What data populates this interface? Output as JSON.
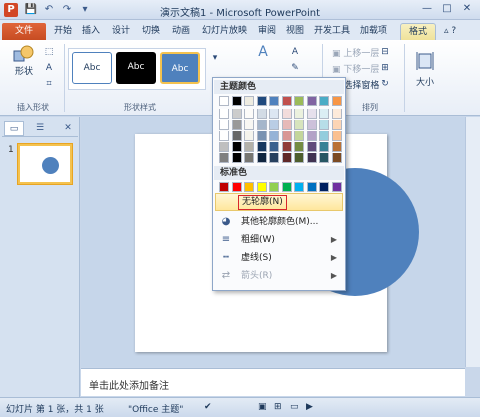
{
  "title_bar": {
    "app_icon": "P",
    "title": "演示文稿1 - Microsoft PowerPoint",
    "qat_icons": [
      "save-icon",
      "undo-icon",
      "redo-icon",
      "customize-icon"
    ],
    "window_buttons": [
      "—",
      "□",
      "✕"
    ]
  },
  "tabs": {
    "file": "文件",
    "items": [
      "开始",
      "插入",
      "设计",
      "切换",
      "动画",
      "幻灯片放映",
      "审阅",
      "视图",
      "开发工具",
      "加载项"
    ],
    "active": "格式"
  },
  "ribbon": {
    "insert_shapes": {
      "button": "形状",
      "label": "插入形状"
    },
    "shape_styles": {
      "tiles": [
        "Abc",
        "Abc",
        "Abc"
      ],
      "label": "形状样式"
    },
    "arrange": {
      "items": [
        "上移一层",
        "下移一层",
        "选择窗格"
      ],
      "label": "排列"
    },
    "size": {
      "button": "大小"
    }
  },
  "outline_menu": {
    "theme_colors_header": "主题颜色",
    "standard_colors_header": "标准色",
    "items": [
      {
        "label": "无轮廓(N)",
        "icon": ""
      },
      {
        "label": "其他轮廓颜色(M)...",
        "icon": "color-wheel-icon"
      },
      {
        "label": "粗细(W)",
        "icon": "line-weight-icon",
        "arrow": "▶"
      },
      {
        "label": "虚线(S)",
        "icon": "dashes-icon",
        "arrow": "▶"
      },
      {
        "label": "箭头(R)",
        "icon": "arrows-icon",
        "arrow": "▶"
      }
    ],
    "theme_top_row": [
      "#ffffff",
      "#000000",
      "#eeece1",
      "#1f497d",
      "#4f81bd",
      "#c0504d",
      "#9bbb59",
      "#8064a2",
      "#4bacc6",
      "#f79646"
    ],
    "standard_colors": [
      "#c00000",
      "#ff0000",
      "#ffc000",
      "#ffff00",
      "#92d050",
      "#00b050",
      "#00b0f0",
      "#0070c0",
      "#002060",
      "#7030a0"
    ]
  },
  "slide_panel": {
    "slide_number": "1"
  },
  "notes": {
    "placeholder": "单击此处添加备注"
  },
  "status_bar": {
    "slide_info": "幻灯片 第 1 张，共 1 张",
    "theme": "\"Office 主题\"",
    "lang_icon": "proofing-icon"
  },
  "colors": {
    "accent_blue": "#4f81bd",
    "file_tab": "#c74c22",
    "highlight": "#ffe79c",
    "selection_box": "#d9262b"
  }
}
